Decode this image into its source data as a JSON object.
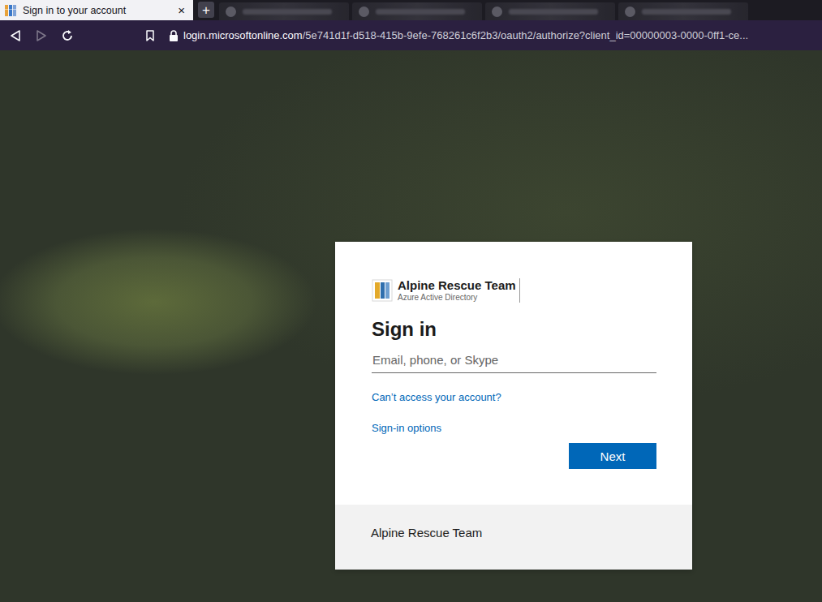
{
  "browser": {
    "tabs": [
      {
        "label": "Sign in to your account",
        "selected": true,
        "close": "×"
      }
    ],
    "new_tab": "+",
    "url": {
      "host": "login.microsoftonline.com",
      "path": "/5e741d1f-d518-415b-9efe-768261c6f2b3/oauth2/authorize?client_id=00000003-0000-0ff1-ce..."
    }
  },
  "signin": {
    "org_name": "Alpine Rescue Team",
    "org_subtitle": "Azure Active Directory",
    "heading": "Sign in",
    "field": {
      "placeholder": "Email, phone, or Skype"
    },
    "links": [
      "Can’t access your account?",
      "Sign-in options"
    ],
    "button": "Next",
    "footer": "Alpine Rescue Team"
  }
}
